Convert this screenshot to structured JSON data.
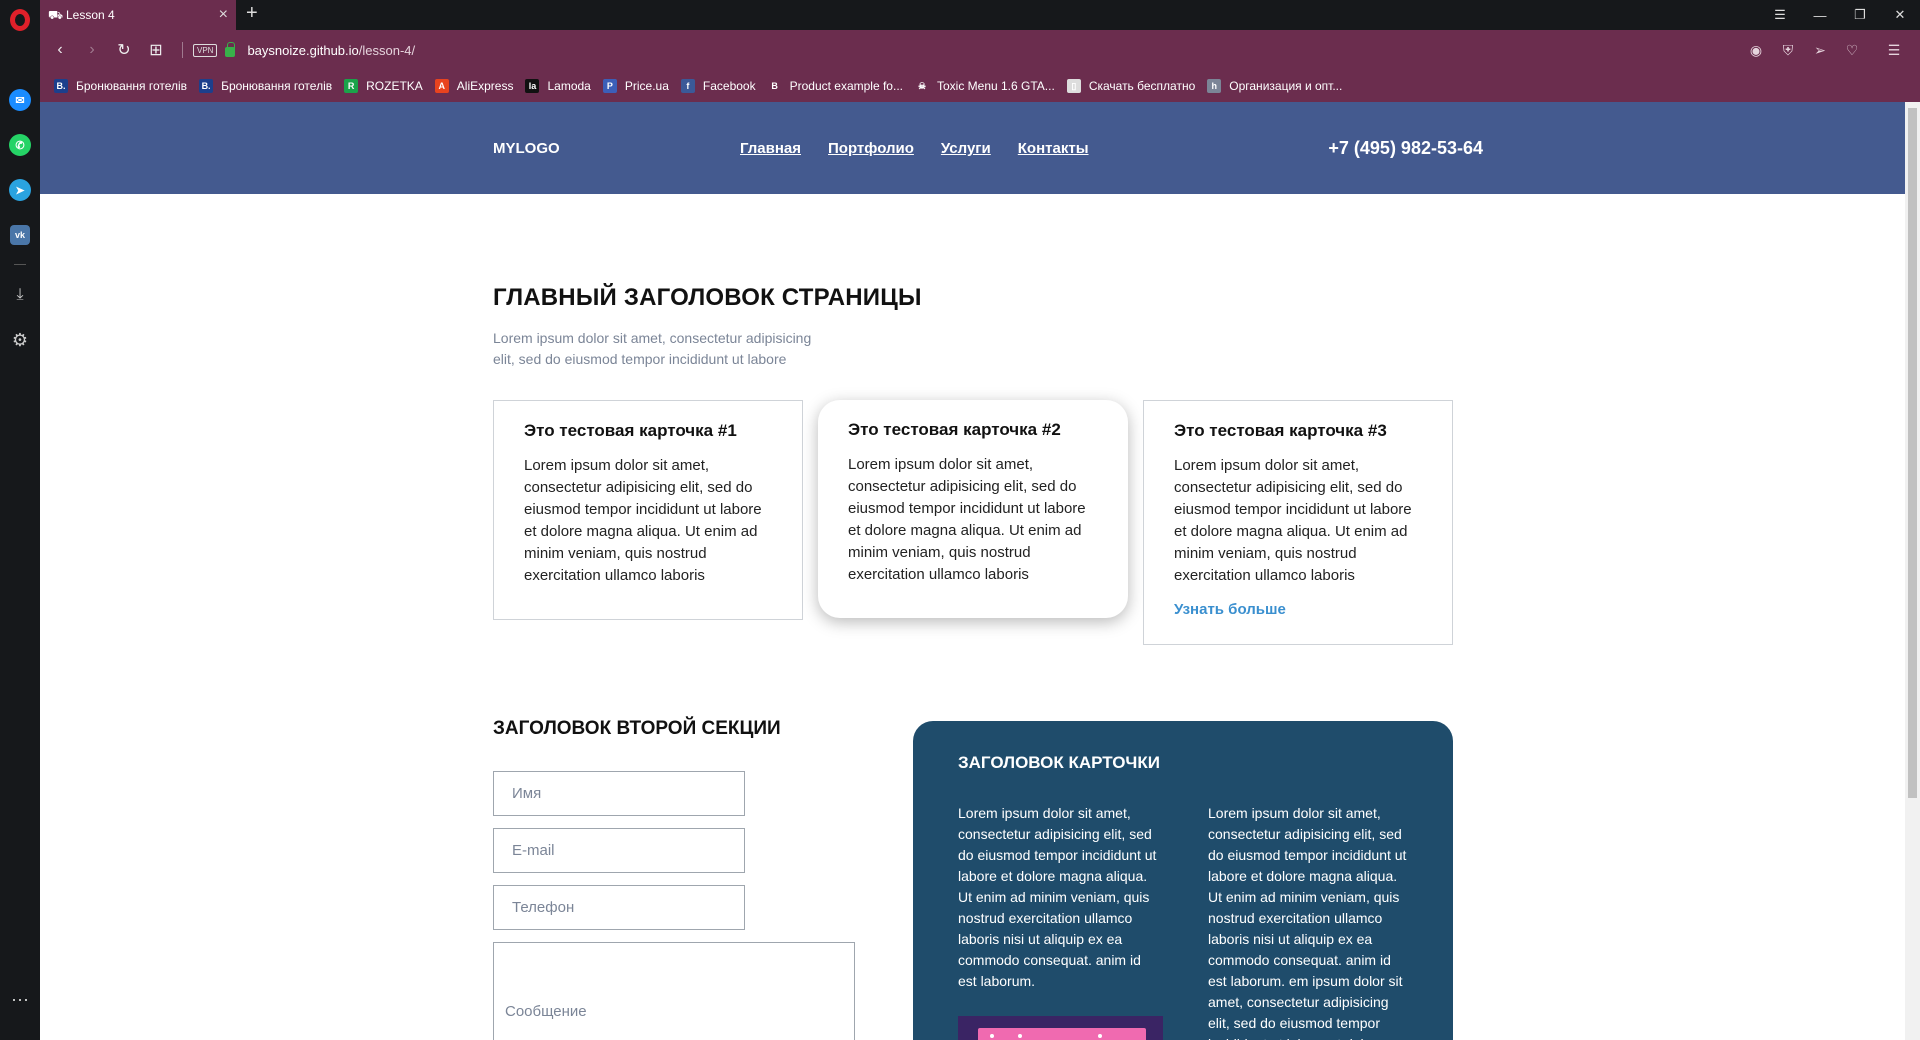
{
  "browser": {
    "tab_title": "Lesson 4",
    "url_host": "baysnoize.github.io",
    "url_path": "/lesson-4/",
    "vpn_label": "VPN",
    "bookmarks": [
      {
        "label": "Бронювання готелів",
        "fav": "B.",
        "color": "#1c3f8c"
      },
      {
        "label": "Бронювання готелів",
        "fav": "B.",
        "color": "#1c3f8c"
      },
      {
        "label": "ROZETKA",
        "fav": "R",
        "color": "#1aa34a"
      },
      {
        "label": "AliExpress",
        "fav": "A",
        "color": "#e8431f"
      },
      {
        "label": "Lamoda",
        "fav": "la",
        "color": "#111111"
      },
      {
        "label": "Price.ua",
        "fav": "P",
        "color": "#3c5fb8"
      },
      {
        "label": "Facebook",
        "fav": "f",
        "color": "#3b5998"
      },
      {
        "label": "Product example fo...",
        "fav": "B",
        "color": "#6b2d4e"
      },
      {
        "label": "Toxic Menu 1.6 GTA...",
        "fav": "☠",
        "color": "#6b2d4e"
      },
      {
        "label": "Скачать бесплатно",
        "fav": "▯",
        "color": "#dddddd"
      },
      {
        "label": "Организация и опт...",
        "fav": "h",
        "color": "#7b8597"
      }
    ]
  },
  "site": {
    "logo": "MYLOGO",
    "nav": [
      "Главная",
      "Портфолио",
      "Услуги",
      "Контакты"
    ],
    "phone": "+7 (495) 982-53-64"
  },
  "hero": {
    "title": "ГЛАВНЫЙ ЗАГОЛОВОК СТРАНИЦЫ",
    "lead": "Lorem ipsum dolor sit amet, consectetur adipisicing elit, sed do eiusmod tempor incididunt ut labore"
  },
  "cards": [
    {
      "title": "Это тестовая карточка #1",
      "text": "Lorem ipsum dolor sit amet, consectetur adipisicing elit, sed do eiusmod tempor incididunt ut labore et dolore magna aliqua. Ut enim ad minim veniam, quis nostrud exercitation ullamco laboris",
      "link": ""
    },
    {
      "title": "Это тестовая карточка #2",
      "text": "Lorem ipsum dolor sit amet, consectetur adipisicing elit, sed do eiusmod tempor incididunt ut labore et dolore magna aliqua. Ut enim ad minim veniam, quis nostrud exercitation ullamco laboris",
      "link": ""
    },
    {
      "title": "Это тестовая карточка #3",
      "text": "Lorem ipsum dolor sit amet, consectetur adipisicing elit, sed do eiusmod tempor incididunt ut labore et dolore magna aliqua. Ut enim ad minim veniam, quis nostrud exercitation ullamco laboris",
      "link": "Узнать больше"
    }
  ],
  "form": {
    "title": "ЗАГОЛОВОК ВТОРОЙ СЕКЦИИ",
    "name_placeholder": "Имя",
    "email_placeholder": "E-mail",
    "phone_placeholder": "Телефон",
    "message_placeholder": "Сообщение"
  },
  "dark_card": {
    "title": "ЗАГОЛОВОК КАРТОЧКИ",
    "col1": "Lorem ipsum dolor sit amet, consectetur adipisicing elit, sed do eiusmod tempor incididunt ut labore et dolore magna aliqua. Ut enim ad minim veniam, quis nostrud exercitation ullamco laboris nisi ut aliquip ex ea commodo consequat. anim id est laborum.",
    "col2": "Lorem ipsum dolor sit amet, consectetur adipisicing elit, sed do eiusmod tempor incididunt ut labore et dolore magna aliqua. Ut enim ad minim veniam, quis nostrud exercitation ullamco laboris nisi ut aliquip ex ea commodo consequat. anim id est laborum. em ipsum dolor sit amet, consectetur adipisicing elit, sed do eiusmod tempor incididunt ut labore et dolore"
  }
}
